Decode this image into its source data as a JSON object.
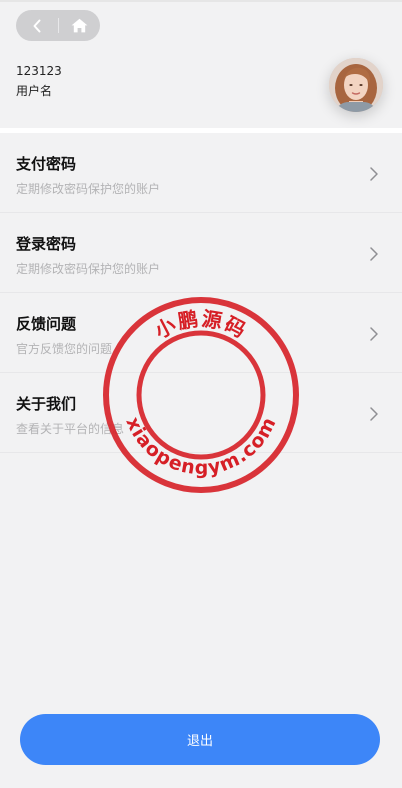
{
  "nav": {
    "back_icon": "chevron-left-icon",
    "home_icon": "home-icon"
  },
  "profile": {
    "user_id": "123123",
    "username": "用户名"
  },
  "menu": [
    {
      "title": "支付密码",
      "desc": "定期修改密码保护您的账户"
    },
    {
      "title": "登录密码",
      "desc": "定期修改密码保护您的账户"
    },
    {
      "title": "反馈问题",
      "desc": "官方反馈您的问题"
    },
    {
      "title": "关于我们",
      "desc": "查看关于平台的信息"
    }
  ],
  "watermark": {
    "top_text": "小鹏源码",
    "bottom_text": "xiaopengym.com",
    "color": "#d61f26"
  },
  "logout_label": "退出",
  "colors": {
    "accent": "#3d86f8",
    "background": "#f2f2f3"
  }
}
